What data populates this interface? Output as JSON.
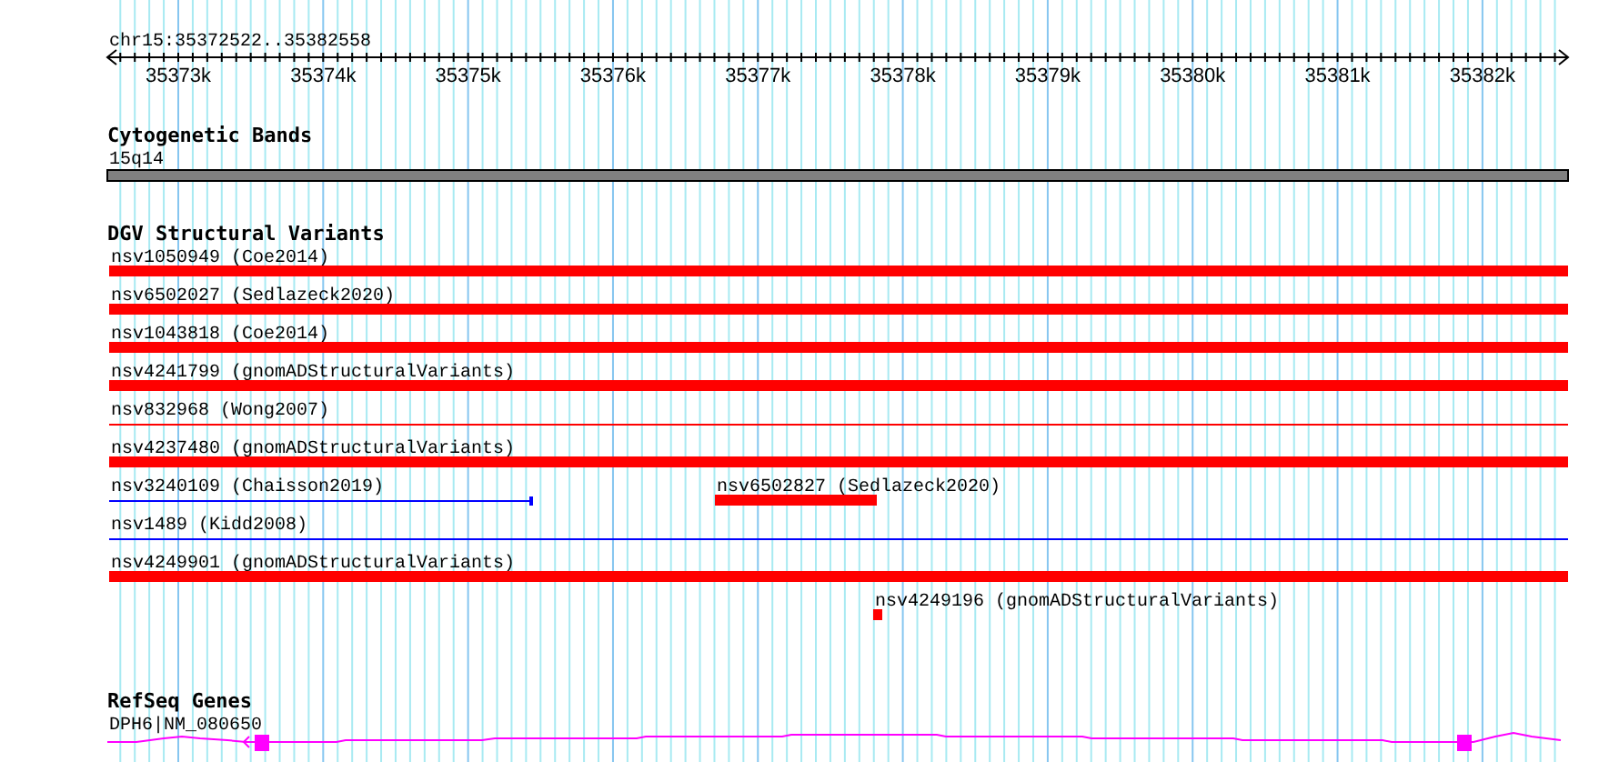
{
  "location": "chr15:35372522..35382558",
  "ruler": {
    "ticks": [
      "35373k",
      "35374k",
      "35375k",
      "35376k",
      "35377k",
      "35378k",
      "35379k",
      "35380k",
      "35381k",
      "35382k"
    ]
  },
  "tracks": [
    {
      "kind": "cytoband",
      "title": "Cytogenetic Bands",
      "features": [
        {
          "label": "15q14"
        }
      ]
    },
    {
      "kind": "variants",
      "title": "DGV Structural Variants",
      "features": [
        {
          "label": "nsv1050949 (Coe2014)",
          "kind": "bar",
          "color": "#ff0000"
        },
        {
          "label": "nsv6502027 (Sedlazeck2020)",
          "kind": "bar",
          "color": "#ff0000"
        },
        {
          "label": "nsv1043818 (Coe2014)",
          "kind": "bar",
          "color": "#ff0000"
        },
        {
          "label": "nsv4241799 (gnomADStructuralVariants)",
          "kind": "bar",
          "color": "#ff0000"
        },
        {
          "label": "nsv832968 (Wong2007)",
          "kind": "line",
          "color": "#ff0000"
        },
        {
          "label": "nsv4237480 (gnomADStructuralVariants)",
          "kind": "bar",
          "color": "#ff0000"
        },
        {
          "label": "nsv3240109 (Chaisson2019)",
          "kind": "line",
          "color": "#0000ff"
        },
        {
          "label": "nsv6502827 (Sedlazeck2020)",
          "kind": "bar",
          "color": "#ff0000"
        },
        {
          "label": "nsv1489 (Kidd2008)",
          "kind": "line",
          "color": "#0000ff"
        },
        {
          "label": "nsv4249901 (gnomADStructuralVariants)",
          "kind": "bar",
          "color": "#ff0000"
        },
        {
          "label": "nsv4249196 (gnomADStructuralVariants)",
          "kind": "bar",
          "color": "#ff0000"
        }
      ]
    },
    {
      "kind": "genes",
      "title": "RefSeq Genes",
      "features": [
        {
          "label": "DPH6|NM_080650",
          "color": "#ff00ff"
        }
      ]
    }
  ]
}
